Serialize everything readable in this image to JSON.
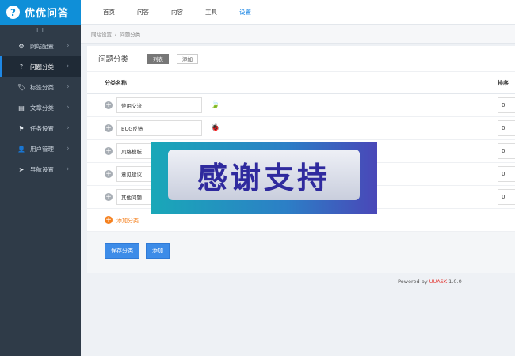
{
  "app": {
    "logo_glyph": "?",
    "name": "优优问答"
  },
  "sidebar": {
    "toggle": "III",
    "items": [
      {
        "label": "网站配置",
        "icon": "⚙",
        "active": false
      },
      {
        "label": "问题分类",
        "icon": "?",
        "active": true
      },
      {
        "label": "标签分类",
        "icon": "🏷",
        "active": false
      },
      {
        "label": "文章分类",
        "icon": "▤",
        "active": false
      },
      {
        "label": "任务设置",
        "icon": "⚑",
        "active": false
      },
      {
        "label": "用户管理",
        "icon": "👤",
        "active": false
      },
      {
        "label": "导航设置",
        "icon": "➤",
        "active": false
      }
    ],
    "chevron": "›"
  },
  "topnav": [
    {
      "label": "首页",
      "active": false
    },
    {
      "label": "问答",
      "active": false
    },
    {
      "label": "内容",
      "active": false
    },
    {
      "label": "工具",
      "active": false
    },
    {
      "label": "设置",
      "active": true
    }
  ],
  "breadcrumb": {
    "parent": "网站设置",
    "sep": "/",
    "current": "问题分类"
  },
  "panel": {
    "title": "问题分类",
    "tab_list": "列表",
    "tab_add": "添加",
    "col_name": "分类名称",
    "col_order": "排序",
    "rows": [
      {
        "name": "使用交流",
        "icon": "🍃",
        "order": "0"
      },
      {
        "name": "BUG反馈",
        "icon": "🐞",
        "order": "0"
      },
      {
        "name": "风格模板",
        "icon": "",
        "order": "0"
      },
      {
        "name": "意见建议",
        "icon": "",
        "order": "0"
      },
      {
        "name": "其他问题",
        "icon": "",
        "order": "0"
      }
    ],
    "add_category": "添加分类",
    "save_button": "保存分类",
    "add_button": "添加"
  },
  "footer": {
    "powered_prefix": "Powered by ",
    "brand": "UUASK",
    "version": " 1.0.0"
  },
  "overlay": {
    "text": "感谢支持"
  },
  "colors": {
    "accent": "#1e88e5",
    "sidebar": "#2f3b48",
    "logo_bar": "#0f8fd8",
    "orange": "#f5811f"
  }
}
